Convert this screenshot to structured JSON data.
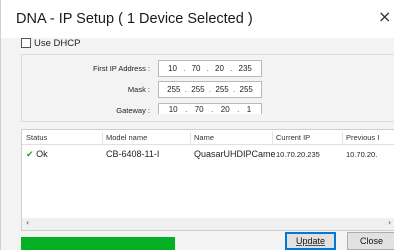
{
  "window": {
    "title": "DNA - IP Setup ( 1 Device Selected )",
    "close_glyph": "×"
  },
  "options": {
    "use_dhcp_label": "Use DHCP",
    "use_dhcp_checked": false
  },
  "network": {
    "first_ip": {
      "label": "First IP Address :",
      "octets": [
        "10",
        "70",
        "20",
        "235"
      ]
    },
    "mask": {
      "label": "Mask :",
      "octets": [
        "255",
        "255",
        "255",
        "255"
      ]
    },
    "gateway": {
      "label": "Gateway :",
      "octets": [
        "10",
        "70",
        "20",
        "1"
      ]
    }
  },
  "device_list": {
    "columns": [
      "Status",
      "Model name",
      "Name",
      "Current IP",
      "Previous I"
    ],
    "rows": [
      {
        "status_icon": "check-icon",
        "status": "Ok",
        "model": "CB-6408-11-I",
        "name": "QuasarUHDIPCame",
        "current_ip": "10.70.20.235",
        "previous_ip": "10.70.20."
      }
    ],
    "scroll_left": "‹",
    "scroll_right": "›"
  },
  "footer": {
    "progress_fraction": 1.0,
    "progress_color": "#06b025",
    "update_label": "Update",
    "close_label": "Close"
  }
}
